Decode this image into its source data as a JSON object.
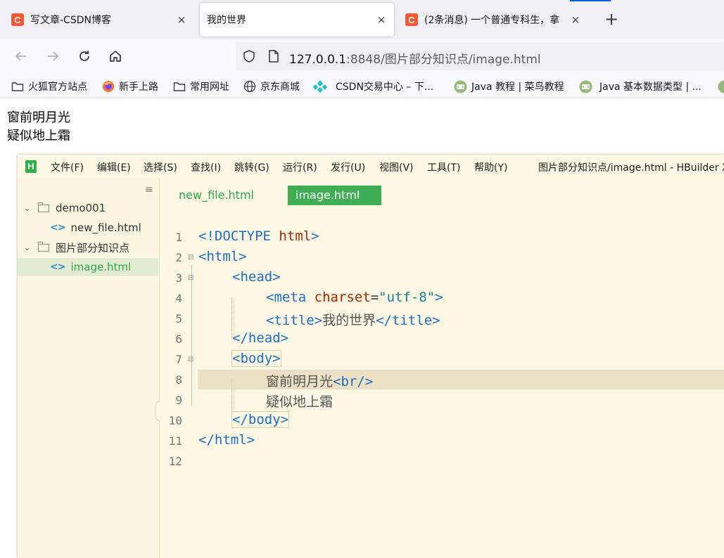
{
  "browser": {
    "tabs": [
      {
        "icon": "C",
        "title": "写文章-CSDN博客",
        "close": "×"
      },
      {
        "title": "我的世界",
        "close": "×",
        "active": true
      },
      {
        "icon": "C",
        "title": "(2条消息) 一个普通专科生，拿",
        "close": "×"
      }
    ],
    "new_tab": "+",
    "url": {
      "host": "127.0.0.1",
      "rest": ":8848/图片部分知识点/image.html"
    },
    "bookmarks": [
      {
        "label": "火狐官方站点",
        "icon": "folder-icon"
      },
      {
        "label": "新手上路",
        "icon": "firefox-icon"
      },
      {
        "label": "常用网址",
        "icon": "folder-icon"
      },
      {
        "label": "京东商城",
        "icon": "globe-icon"
      },
      {
        "label": "CSDN交易中心 – 下...",
        "icon": "csdn-icon"
      },
      {
        "label": "Java 教程 | 菜鸟教程",
        "icon": "runoob-icon"
      },
      {
        "label": "Java 基本数据类型 | ...",
        "icon": "runoob-icon"
      }
    ]
  },
  "page": {
    "line1": "窗前明月光",
    "line2": "疑似地上霜"
  },
  "hbuilder": {
    "logo": "H",
    "menu": [
      "文件(F)",
      "编辑(E)",
      "选择(S)",
      "查找(I)",
      "跳转(G)",
      "运行(R)",
      "发行(U)",
      "视图(V)",
      "工具(T)",
      "帮助(Y)"
    ],
    "title": "图片部分知识点/image.html - HBuilder X",
    "sidebar_menu": "≡",
    "tree": [
      {
        "label": "demo001",
        "type": "folder"
      },
      {
        "label": "new_file.html",
        "type": "file"
      },
      {
        "label": "图片部分知识点",
        "type": "folder"
      },
      {
        "label": "image.html",
        "type": "file",
        "selected": true
      }
    ],
    "tabs": [
      {
        "label": "new_file.html"
      },
      {
        "label": "image.html",
        "active": true
      }
    ],
    "collapse": "‹",
    "line_numbers": [
      "1",
      "2",
      "3",
      "4",
      "5",
      "6",
      "7",
      "8",
      "9",
      "10",
      "11",
      "12"
    ],
    "code": {
      "doctype_open": "<!DOCTYPE ",
      "doctype_kw": "html",
      "doctype_close": ">",
      "html_open": "<html>",
      "head_open": "<head>",
      "meta_tag": "<meta ",
      "meta_attr": "charset",
      "meta_eq": "=",
      "meta_val": "\"utf-8\"",
      "meta_close": ">",
      "title_open": "<title>",
      "title_text": "我的世界",
      "title_close": "</title>",
      "head_close": "</head>",
      "body_open": "<body>",
      "line8_text": "窗前明月光",
      "br": "<br/>",
      "line9_text": "疑似地上霜",
      "body_close": "</body>",
      "html_close": "</html>"
    }
  },
  "colors": {
    "accent_green": "#3fae54",
    "csdn_red": "#fc5531",
    "editor_bg": "#fdf8e4"
  }
}
